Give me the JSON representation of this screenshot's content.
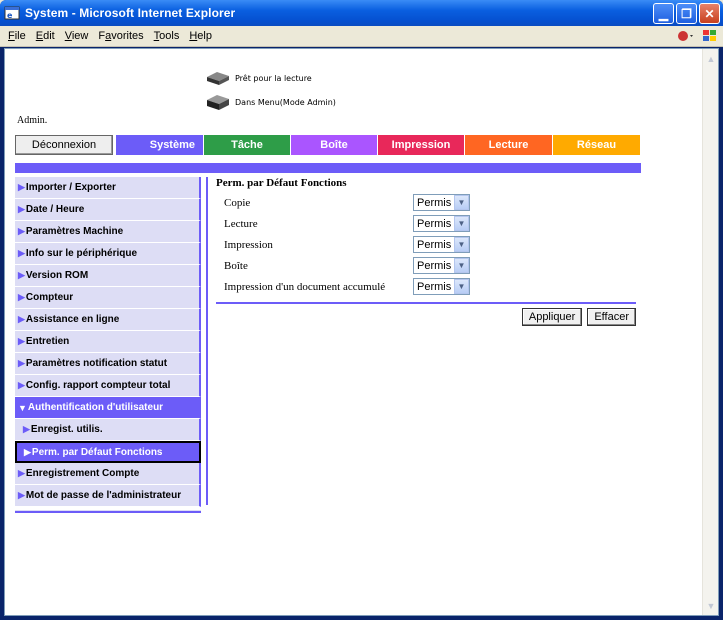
{
  "window": {
    "title": "System - Microsoft Internet Explorer"
  },
  "menu": {
    "items": [
      {
        "label": "File",
        "u": "F"
      },
      {
        "label": "Edit",
        "u": "E"
      },
      {
        "label": "View",
        "u": "V"
      },
      {
        "label": "Favorites",
        "u": "a"
      },
      {
        "label": "Tools",
        "u": "T"
      },
      {
        "label": "Help",
        "u": "H"
      }
    ]
  },
  "status": {
    "line1": "Prêt pour la lecture",
    "line2": "Dans Menu(Mode Admin)"
  },
  "admin_label": "Admin.",
  "tabs": {
    "logout": "Déconnexion",
    "systeme": "Système",
    "tache": "Tâche",
    "boite": "Boîte",
    "impression": "Impression",
    "lecture": "Lecture",
    "reseau": "Réseau"
  },
  "sidebar": {
    "items": [
      "Importer / Exporter",
      "Date / Heure",
      "Paramètres Machine",
      "Info sur le périphérique",
      "Version ROM",
      "Compteur",
      "Assistance en ligne",
      "Entretien",
      "Paramètres notification statut",
      "Config. rapport compteur total",
      "Authentification d'utilisateur",
      "Enregist. utilis.",
      "Perm. par Défaut Fonctions",
      "Enregistrement Compte",
      "Mot de passe de l'administrateur"
    ]
  },
  "content": {
    "heading": "Perm. par Défaut Fonctions",
    "rows": [
      {
        "label": "Copie",
        "value": "Permis"
      },
      {
        "label": "Lecture",
        "value": "Permis"
      },
      {
        "label": "Impression",
        "value": "Permis"
      },
      {
        "label": "Boîte",
        "value": "Permis"
      },
      {
        "label": "Impression d'un document accumulé",
        "value": "Permis"
      }
    ],
    "apply": "Appliquer",
    "clear": "Effacer"
  }
}
